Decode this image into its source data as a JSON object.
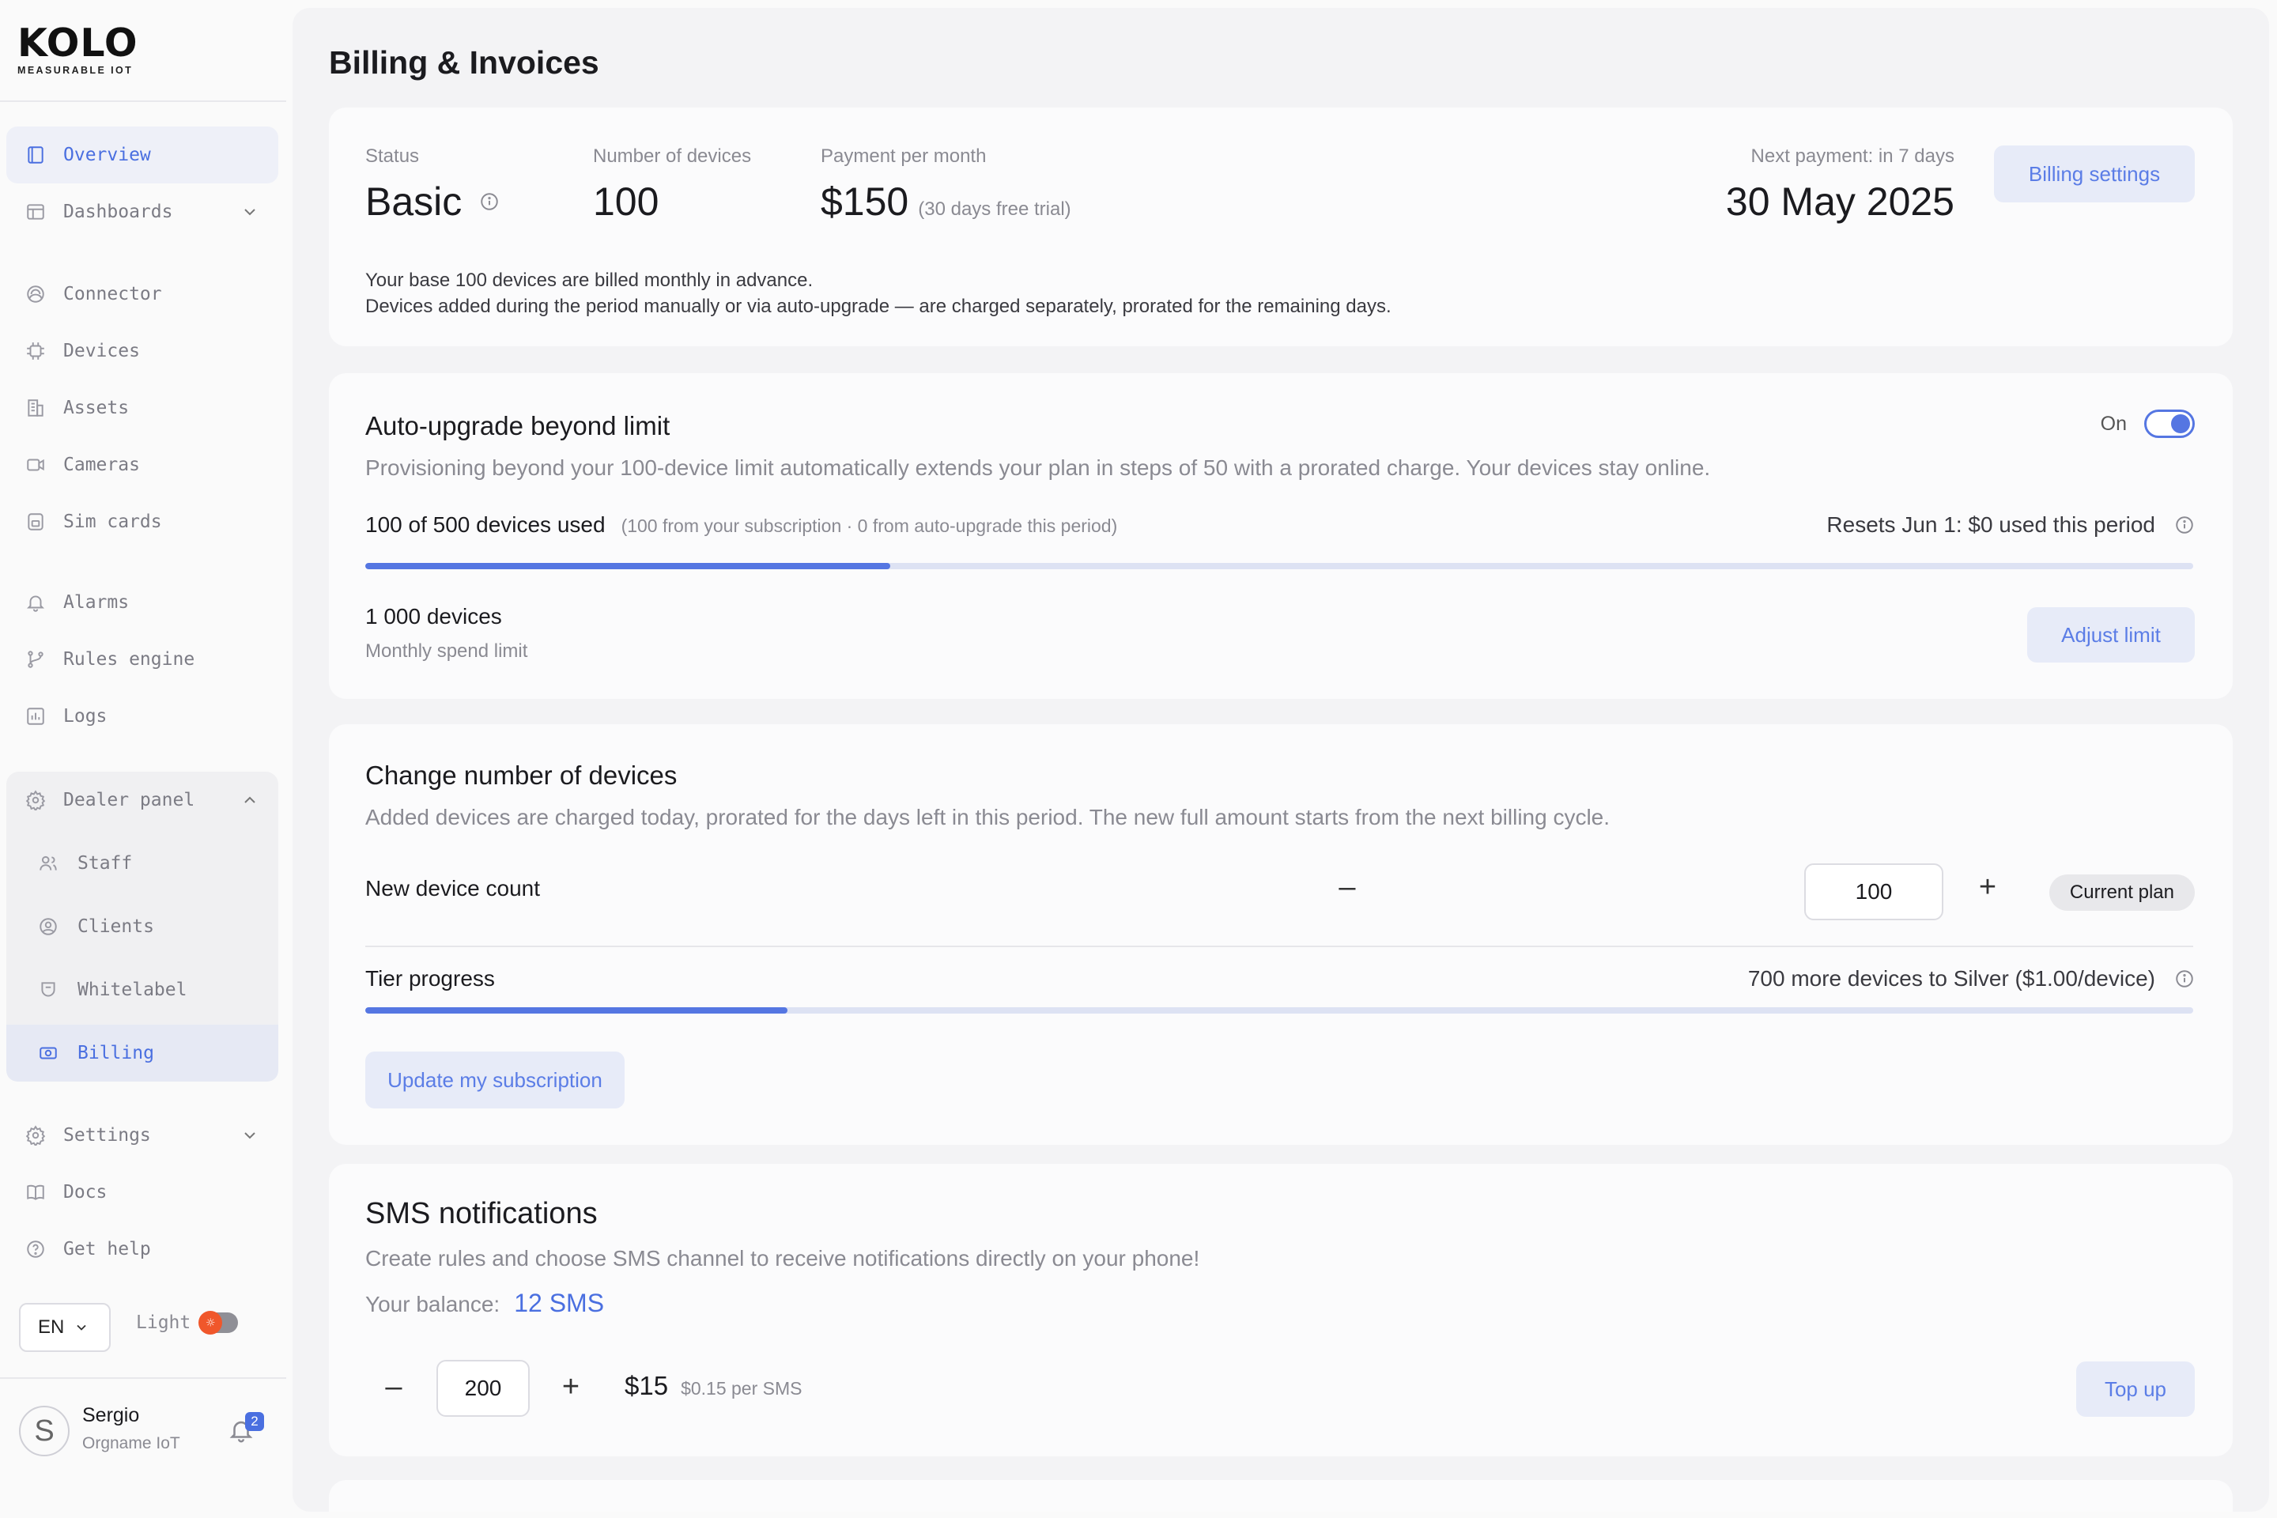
{
  "brand": {
    "logo_text": "KOLO",
    "tagline": "MEASURABLE IOT"
  },
  "nav": {
    "overview": "Overview",
    "dashboards": "Dashboards",
    "connector": "Connector",
    "devices": "Devices",
    "assets": "Assets",
    "cameras": "Cameras",
    "sim_cards": "Sim cards",
    "alarms": "Alarms",
    "rules_engine": "Rules engine",
    "logs": "Logs",
    "dealer_panel": "Dealer panel",
    "staff": "Staff",
    "clients": "Clients",
    "whitelabel": "Whitelabel",
    "billing": "Billing",
    "settings": "Settings",
    "docs": "Docs",
    "get_help": "Get help"
  },
  "footer": {
    "language": "EN",
    "theme_label": "Light",
    "user_initial": "S",
    "user_name": "Sergio",
    "user_org": "Orgname IoT",
    "notifications": "2"
  },
  "page": {
    "title": "Billing & Invoices"
  },
  "plan": {
    "status_label": "Status",
    "status_value": "Basic",
    "devices_label": "Number of devices",
    "devices_value": "100",
    "payment_label": "Payment per month",
    "payment_value": "$150",
    "payment_note": "(30 days free trial)",
    "next_payment_label": "Next payment: in 7 days",
    "next_payment_value": "30 May 2025",
    "billing_settings": "Billing settings",
    "note_line1": "Your base 100 devices are billed monthly in advance.",
    "note_line2": "Devices added during the period manually or via auto-upgrade — are charged separately, prorated for the remaining days."
  },
  "auto_upgrade": {
    "title": "Auto-upgrade beyond limit",
    "toggle_label": "On",
    "toggle_on": true,
    "description": "Provisioning beyond your 100-device limit automatically extends your plan in steps of 50 with a prorated charge. Your devices stay online.",
    "usage": "100 of 500 devices used",
    "usage_detail": "(100 from your subscription · 0 from auto-upgrade this period)",
    "resets": "Resets Jun 1: $0 used this period",
    "progress": 0.287,
    "limit_value": "1 000 devices",
    "limit_label": "Monthly spend limit",
    "adjust_limit": "Adjust limit"
  },
  "change_devices": {
    "title": "Change number of devices",
    "description": "Added devices are charged today, prorated for the days left in this period. The new full amount starts from the next billing cycle.",
    "count_label": "New device count",
    "minus": "–",
    "plus": "+",
    "count_value": "100",
    "current_plan": "Current plan",
    "tier_label": "Tier progress",
    "tier_note": "700 more devices to Silver ($1.00/device)",
    "tier_progress": 0.231,
    "update_button": "Update my subscription"
  },
  "sms": {
    "title": "SMS notifications",
    "description": "Create rules and choose SMS channel to receive notifications directly on your phone!",
    "balance_label": "Your balance:",
    "balance_value": "12 SMS",
    "minus": "–",
    "plus": "+",
    "quantity": "200",
    "price": "$15",
    "unit_price": "$0.15 per SMS",
    "top_up": "Top up"
  },
  "colors": {
    "accent": "#4a6fe0",
    "soft_accent": "#e7ebf8",
    "toggle_orange": "#f0572b"
  }
}
